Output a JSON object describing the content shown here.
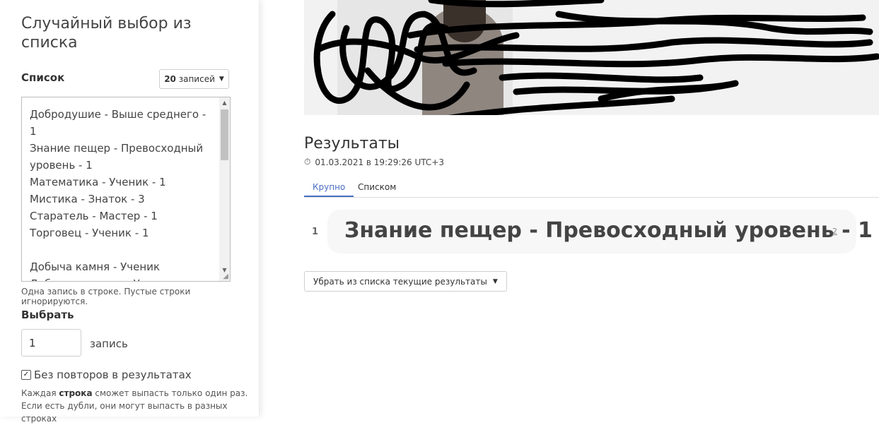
{
  "sidebar": {
    "title": "Случайный выбор из списка",
    "list_label": "Список",
    "count_select": {
      "value": "20",
      "unit": "записей"
    },
    "list_lines": "Добродушие - Выше среднего - 1\nЗнание пещер - Превосходный уровень - 1\nМатематика - Ученик - 1\nМистика - Знаток - 3\nСтаратель - Мастер - 1\nТорговец - Ученик - 1\n\nДобыча камня - Ученик\nДобыча металла - Ученик",
    "list_hint": "Одна запись в строке. Пустые строки игнорируются.",
    "choose_label": "Выбрать",
    "quantity_value": "1",
    "quantity_unit": "запись",
    "no_repeat_label": "Без повторов в результатах",
    "no_repeat_checked": true,
    "hint_prefix": "Каждая",
    "hint_bold": "строка",
    "hint_rest": "сможет выпасть только один раз.",
    "hint_line2": "Если есть дубли, они могут выпасть в разных строках"
  },
  "results": {
    "title": "Результаты",
    "timestamp": "01.03.2021 в 19:29:26 UTC+3",
    "tabs": [
      "Крупно",
      "Списком"
    ],
    "active_tab": "Крупно",
    "items": [
      {
        "index": "1",
        "text": "Знание пещер - Превосходный уровень - 1",
        "sub": "2"
      }
    ],
    "remove_button_label": "Убрать из списка текущие результаты"
  },
  "colors": {
    "accent": "#4a6fc4"
  },
  "icons": {
    "timer": "stopwatch-icon",
    "chevron": "chevron-down-icon",
    "check": "check-icon"
  }
}
